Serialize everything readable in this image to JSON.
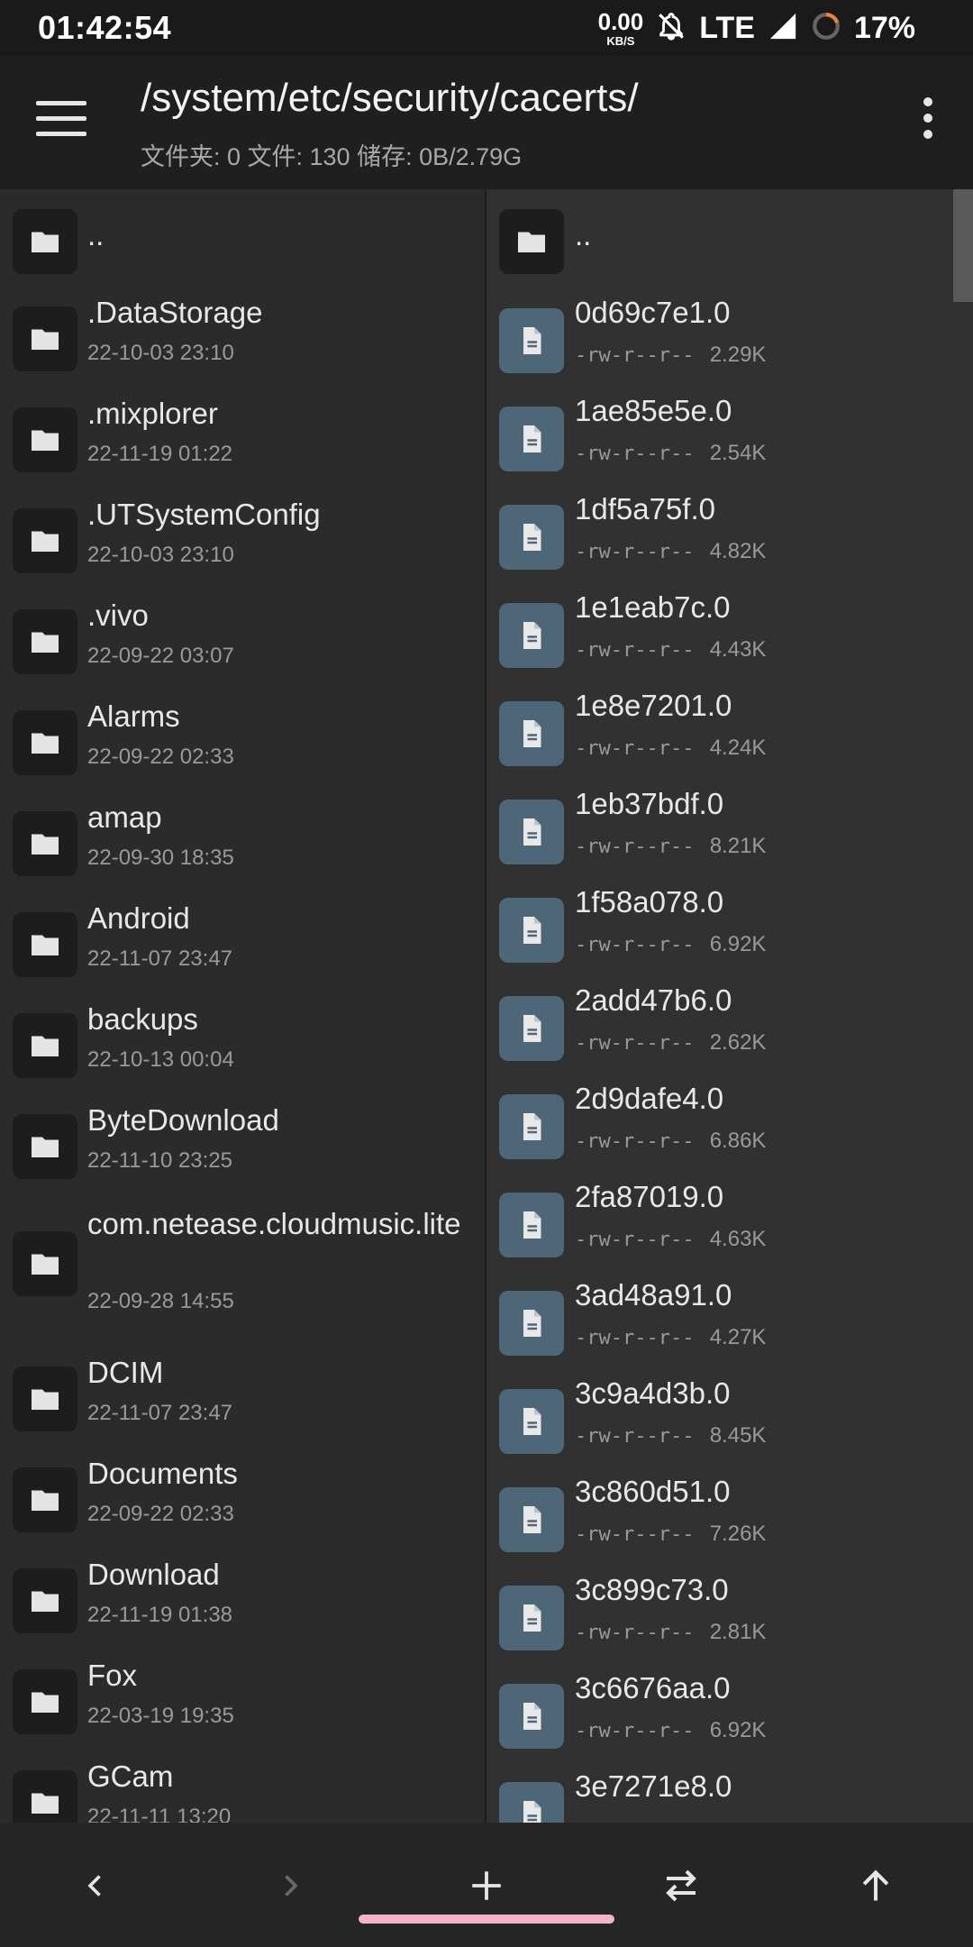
{
  "status": {
    "time": "01:42:54",
    "speed_value": "0.00",
    "speed_unit": "KB/S",
    "network": "LTE",
    "battery": "17%"
  },
  "toolbar": {
    "path": "/system/etc/security/cacerts/",
    "summary": "文件夹: 0  文件: 130  储存: 0B/2.79G"
  },
  "left_pane": {
    "parent": "..",
    "items": [
      {
        "name": ".DataStorage",
        "date": "22-10-03 23:10"
      },
      {
        "name": ".mixplorer",
        "date": "22-11-19 01:22"
      },
      {
        "name": ".UTSystemConfig",
        "date": "22-10-03 23:10"
      },
      {
        "name": ".vivo",
        "date": "22-09-22 03:07"
      },
      {
        "name": "Alarms",
        "date": "22-09-22 02:33"
      },
      {
        "name": "amap",
        "date": "22-09-30 18:35"
      },
      {
        "name": "Android",
        "date": "22-11-07 23:47"
      },
      {
        "name": "backups",
        "date": "22-10-13 00:04"
      },
      {
        "name": "ByteDownload",
        "date": "22-11-10 23:25"
      },
      {
        "name": "com.netease.cloudmusic.lite",
        "date": "22-09-28 14:55"
      },
      {
        "name": "DCIM",
        "date": "22-11-07 23:47"
      },
      {
        "name": "Documents",
        "date": "22-09-22 02:33"
      },
      {
        "name": "Download",
        "date": "22-11-19 01:38"
      },
      {
        "name": "Fox",
        "date": "22-03-19 19:35"
      },
      {
        "name": "GCam",
        "date": "22-11-11 13:20"
      }
    ]
  },
  "right_pane": {
    "parent": "..",
    "items": [
      {
        "name": "0d69c7e1.0",
        "perm": "-rw-r--r--",
        "size": "2.29K"
      },
      {
        "name": "1ae85e5e.0",
        "perm": "-rw-r--r--",
        "size": "2.54K"
      },
      {
        "name": "1df5a75f.0",
        "perm": "-rw-r--r--",
        "size": "4.82K"
      },
      {
        "name": "1e1eab7c.0",
        "perm": "-rw-r--r--",
        "size": "4.43K"
      },
      {
        "name": "1e8e7201.0",
        "perm": "-rw-r--r--",
        "size": "4.24K"
      },
      {
        "name": "1eb37bdf.0",
        "perm": "-rw-r--r--",
        "size": "8.21K"
      },
      {
        "name": "1f58a078.0",
        "perm": "-rw-r--r--",
        "size": "6.92K"
      },
      {
        "name": "2add47b6.0",
        "perm": "-rw-r--r--",
        "size": "2.62K"
      },
      {
        "name": "2d9dafe4.0",
        "perm": "-rw-r--r--",
        "size": "6.86K"
      },
      {
        "name": "2fa87019.0",
        "perm": "-rw-r--r--",
        "size": "4.63K"
      },
      {
        "name": "3ad48a91.0",
        "perm": "-rw-r--r--",
        "size": "4.27K"
      },
      {
        "name": "3c9a4d3b.0",
        "perm": "-rw-r--r--",
        "size": "8.45K"
      },
      {
        "name": "3c860d51.0",
        "perm": "-rw-r--r--",
        "size": "7.26K"
      },
      {
        "name": "3c899c73.0",
        "perm": "-rw-r--r--",
        "size": "2.81K"
      },
      {
        "name": "3c6676aa.0",
        "perm": "-rw-r--r--",
        "size": "6.92K"
      },
      {
        "name": "3e7271e8.0",
        "perm": "",
        "size": ""
      }
    ]
  },
  "colors": {
    "accent_gesture": "#f3b4c6",
    "file_icon_bg": "#4d6678"
  }
}
